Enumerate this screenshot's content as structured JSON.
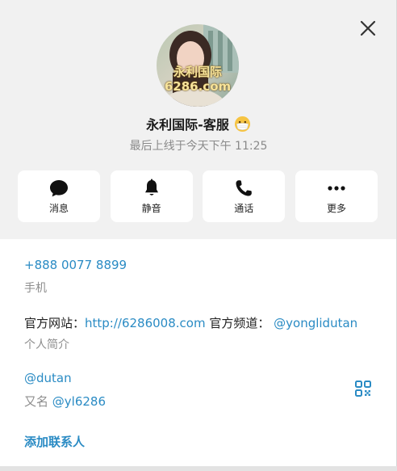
{
  "profile": {
    "name": "永利国际-客服",
    "status_emoji": "mask-face-emoji",
    "last_seen": "最后上线于今天下午 11:25",
    "avatar_text_line1": "永利国际",
    "avatar_text_line2": "6286.com"
  },
  "actions": [
    {
      "label": "消息",
      "icon": "chat-bubble-icon"
    },
    {
      "label": "静音",
      "icon": "bell-icon"
    },
    {
      "label": "通话",
      "icon": "phone-icon"
    },
    {
      "label": "更多",
      "icon": "more-dots-icon"
    }
  ],
  "info": {
    "phone": "+888 0077 8899",
    "phone_label": "手机",
    "bio_prefix": "官方网站：",
    "bio_link": "http://6286008.com",
    "bio_middle": " 官方频道：",
    "bio_channel": "@yonglidutan",
    "bio_label": "个人简介",
    "username": "@dutan",
    "alias_prefix": "又名 ",
    "alias_value": "@yl6286",
    "add_contact": "添加联系人"
  },
  "colors": {
    "accent": "#2a8bc4",
    "panel_bg": "#f1f1f1",
    "card_bg": "#ffffff",
    "muted": "#8d8d8d"
  }
}
